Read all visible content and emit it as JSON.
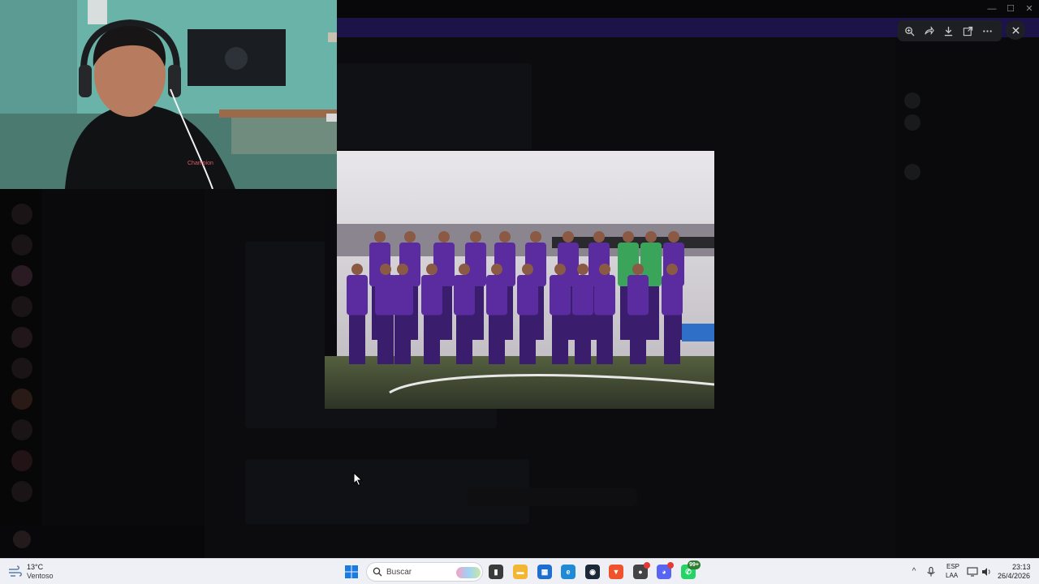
{
  "window": {
    "title": ""
  },
  "viewer": {
    "tools": [
      "zoom-icon",
      "share-icon",
      "download-icon",
      "open-external-icon",
      "more-icon"
    ],
    "close_icon": "close-icon"
  },
  "taskbar": {
    "weather": {
      "temp": "13°C",
      "desc": "Ventoso"
    },
    "search_placeholder": "Buscar",
    "apps": [
      {
        "name": "file-manager-icon",
        "color": "#3b3b3b"
      },
      {
        "name": "folder-icon",
        "color": "#f2b632"
      },
      {
        "name": "store-icon",
        "color": "#1f6fd1"
      },
      {
        "name": "edge-icon",
        "color": "#1f8ad6"
      },
      {
        "name": "steam-icon",
        "color": "#1b2838"
      },
      {
        "name": "brave-icon",
        "color": "#f0532b"
      },
      {
        "name": "chrome-icon",
        "color": "#444444"
      },
      {
        "name": "discord-icon",
        "color": "#5865f2"
      },
      {
        "name": "whatsapp-icon",
        "color": "#25d366"
      }
    ],
    "whatsapp_badge": "99+",
    "language": {
      "line1": "ESP",
      "line2": "LAA"
    },
    "clock": {
      "time": "23:13",
      "date": "26/4/2026"
    }
  },
  "colors": {
    "accent": "#5865f2",
    "jersey": "#5a2ca0",
    "keeper": "#3aa55a"
  }
}
